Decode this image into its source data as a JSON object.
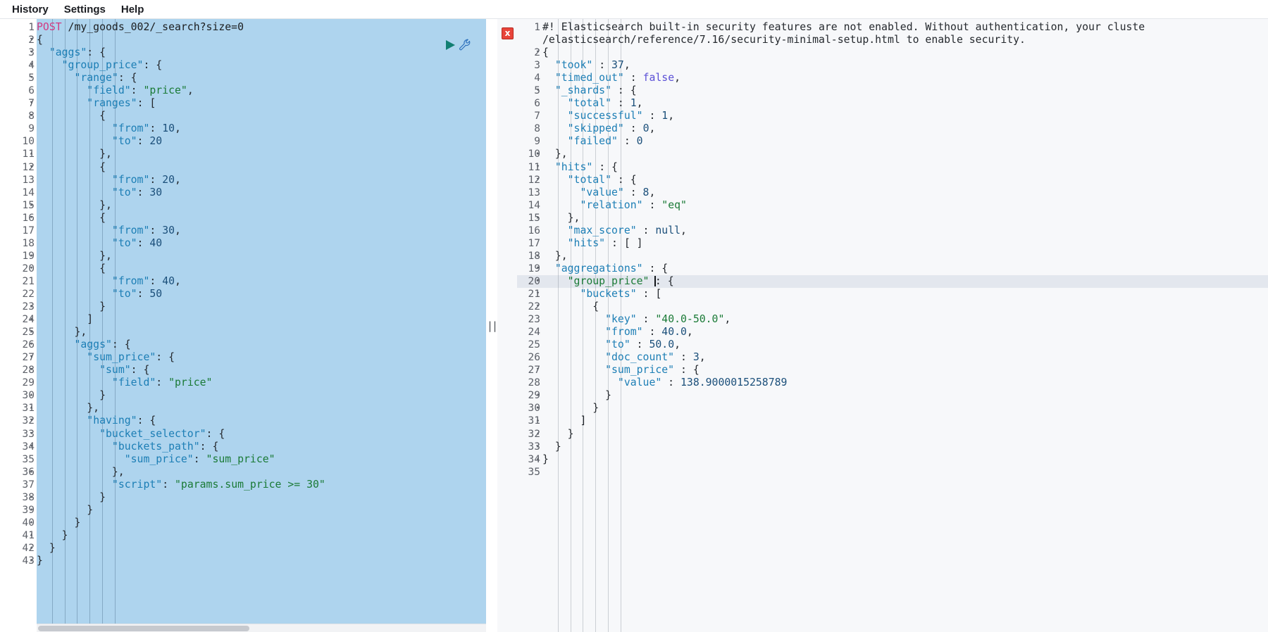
{
  "menubar": {
    "items": [
      {
        "label": "History",
        "name": "menu-item-history"
      },
      {
        "label": "Settings",
        "name": "menu-item-settings"
      },
      {
        "label": "Help",
        "name": "menu-item-help"
      }
    ]
  },
  "request_editor": {
    "method": "POST",
    "url": "/my_goods_002/_search?size=0",
    "run_icon": "play-icon",
    "wrench_icon": "wrench-icon",
    "total_lines": 43,
    "lines": [
      {
        "n": 1,
        "fold": "",
        "text": "POST /my_goods_002/_search?size=0"
      },
      {
        "n": 2,
        "fold": "▾",
        "text": "{"
      },
      {
        "n": 3,
        "fold": "▾",
        "text": "  \"aggs\": {"
      },
      {
        "n": 4,
        "fold": "▾",
        "text": "    \"group_price\": {"
      },
      {
        "n": 5,
        "fold": "▾",
        "text": "      \"range\": {"
      },
      {
        "n": 6,
        "fold": "",
        "text": "        \"field\": \"price\","
      },
      {
        "n": 7,
        "fold": "▾",
        "text": "        \"ranges\": ["
      },
      {
        "n": 8,
        "fold": "▾",
        "text": "          {"
      },
      {
        "n": 9,
        "fold": "",
        "text": "            \"from\": 10,"
      },
      {
        "n": 10,
        "fold": "",
        "text": "            \"to\": 20"
      },
      {
        "n": 11,
        "fold": "▴",
        "text": "          },"
      },
      {
        "n": 12,
        "fold": "▾",
        "text": "          {"
      },
      {
        "n": 13,
        "fold": "",
        "text": "            \"from\": 20,"
      },
      {
        "n": 14,
        "fold": "",
        "text": "            \"to\": 30"
      },
      {
        "n": 15,
        "fold": "▴",
        "text": "          },"
      },
      {
        "n": 16,
        "fold": "▾",
        "text": "          {"
      },
      {
        "n": 17,
        "fold": "",
        "text": "            \"from\": 30,"
      },
      {
        "n": 18,
        "fold": "",
        "text": "            \"to\": 40"
      },
      {
        "n": 19,
        "fold": "▴",
        "text": "          },"
      },
      {
        "n": 20,
        "fold": "▾",
        "text": "          {"
      },
      {
        "n": 21,
        "fold": "",
        "text": "            \"from\": 40,"
      },
      {
        "n": 22,
        "fold": "",
        "text": "            \"to\": 50"
      },
      {
        "n": 23,
        "fold": "▴",
        "text": "          }"
      },
      {
        "n": 24,
        "fold": "▴",
        "text": "        ]"
      },
      {
        "n": 25,
        "fold": "▴",
        "text": "      },"
      },
      {
        "n": 26,
        "fold": "▾",
        "text": "      \"aggs\": {"
      },
      {
        "n": 27,
        "fold": "▾",
        "text": "        \"sum_price\": {"
      },
      {
        "n": 28,
        "fold": "▾",
        "text": "          \"sum\": {"
      },
      {
        "n": 29,
        "fold": "",
        "text": "            \"field\": \"price\""
      },
      {
        "n": 30,
        "fold": "▴",
        "text": "          }"
      },
      {
        "n": 31,
        "fold": "▴",
        "text": "        },"
      },
      {
        "n": 32,
        "fold": "▾",
        "text": "        \"having\": {"
      },
      {
        "n": 33,
        "fold": "▾",
        "text": "          \"bucket_selector\": {"
      },
      {
        "n": 34,
        "fold": "▾",
        "text": "            \"buckets_path\": {"
      },
      {
        "n": 35,
        "fold": "",
        "text": "              \"sum_price\": \"sum_price\""
      },
      {
        "n": 36,
        "fold": "▴",
        "text": "            },"
      },
      {
        "n": 37,
        "fold": "",
        "text": "            \"script\": \"params.sum_price >= 30\""
      },
      {
        "n": 38,
        "fold": "▴",
        "text": "          }"
      },
      {
        "n": 39,
        "fold": "▴",
        "text": "        }"
      },
      {
        "n": 40,
        "fold": "▴",
        "text": "      }"
      },
      {
        "n": 41,
        "fold": "▴",
        "text": "    }"
      },
      {
        "n": 42,
        "fold": "▴",
        "text": "  }"
      },
      {
        "n": 43,
        "fold": "▴",
        "text": "}"
      }
    ]
  },
  "response_panel": {
    "error_badge": "error-icon",
    "error_badge_label": "x",
    "active_line": 20,
    "total_lines": 35,
    "warning_line_1": "#! Elasticsearch built-in security features are not enabled. Without authentication, your cluste",
    "warning_line_2": "/elasticsearch/reference/7.16/security-minimal-setup.html to enable security.",
    "lines": [
      {
        "n": 2,
        "fold": "▾",
        "text": "{"
      },
      {
        "n": 3,
        "fold": "",
        "text": "  \"took\" : 37,"
      },
      {
        "n": 4,
        "fold": "",
        "text": "  \"timed_out\" : false,"
      },
      {
        "n": 5,
        "fold": "▾",
        "text": "  \"_shards\" : {"
      },
      {
        "n": 6,
        "fold": "",
        "text": "    \"total\" : 1,"
      },
      {
        "n": 7,
        "fold": "",
        "text": "    \"successful\" : 1,"
      },
      {
        "n": 8,
        "fold": "",
        "text": "    \"skipped\" : 0,"
      },
      {
        "n": 9,
        "fold": "",
        "text": "    \"failed\" : 0"
      },
      {
        "n": 10,
        "fold": "▴",
        "text": "  },"
      },
      {
        "n": 11,
        "fold": "▾",
        "text": "  \"hits\" : {"
      },
      {
        "n": 12,
        "fold": "▾",
        "text": "    \"total\" : {"
      },
      {
        "n": 13,
        "fold": "",
        "text": "      \"value\" : 8,"
      },
      {
        "n": 14,
        "fold": "",
        "text": "      \"relation\" : \"eq\""
      },
      {
        "n": 15,
        "fold": "▴",
        "text": "    },"
      },
      {
        "n": 16,
        "fold": "",
        "text": "    \"max_score\" : null,"
      },
      {
        "n": 17,
        "fold": "",
        "text": "    \"hits\" : [ ]"
      },
      {
        "n": 18,
        "fold": "▴",
        "text": "  },"
      },
      {
        "n": 19,
        "fold": "▾",
        "text": "  \"aggregations\" : {"
      },
      {
        "n": 20,
        "fold": "▾",
        "text": "    \"group_price\" : {",
        "caret_after": "    \"group_price\" "
      },
      {
        "n": 21,
        "fold": "▾",
        "text": "      \"buckets\" : ["
      },
      {
        "n": 22,
        "fold": "▾",
        "text": "        {"
      },
      {
        "n": 23,
        "fold": "",
        "text": "          \"key\" : \"40.0-50.0\","
      },
      {
        "n": 24,
        "fold": "",
        "text": "          \"from\" : 40.0,"
      },
      {
        "n": 25,
        "fold": "",
        "text": "          \"to\" : 50.0,"
      },
      {
        "n": 26,
        "fold": "",
        "text": "          \"doc_count\" : 3,"
      },
      {
        "n": 27,
        "fold": "▾",
        "text": "          \"sum_price\" : {"
      },
      {
        "n": 28,
        "fold": "",
        "text": "            \"value\" : 138.9000015258789"
      },
      {
        "n": 29,
        "fold": "▴",
        "text": "          }"
      },
      {
        "n": 30,
        "fold": "▴",
        "text": "        }"
      },
      {
        "n": 31,
        "fold": "▴",
        "text": "      ]"
      },
      {
        "n": 32,
        "fold": "▴",
        "text": "    }"
      },
      {
        "n": 33,
        "fold": "▴",
        "text": "  }"
      },
      {
        "n": 34,
        "fold": "▴",
        "text": "}"
      },
      {
        "n": 35,
        "fold": "",
        "text": ""
      }
    ]
  },
  "splitter": {
    "grip": "||",
    "name": "panel-splitter"
  },
  "colors": {
    "request_background": "#aed4ee",
    "response_background": "#f7f8fa",
    "active_line": "#e3e7ee",
    "error_red": "#e8443a",
    "run_green": "#127f72",
    "wrench_blue": "#2a6ebb",
    "method_pink": "#d13a81",
    "key_blue": "#1c7eb5",
    "string_green": "#1a7a36",
    "number_navy": "#1b4f7a",
    "bool_purple": "#5a4fd6"
  }
}
